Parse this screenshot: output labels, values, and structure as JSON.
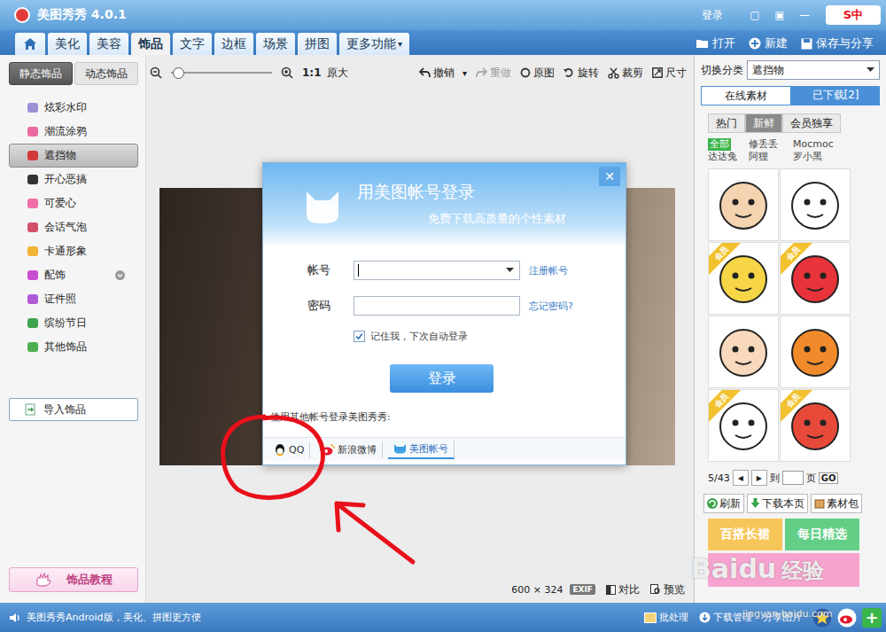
{
  "window": {
    "title": "美图秀秀 4.0.1",
    "login": "登录",
    "controls": [
      "▢",
      "▣",
      "—"
    ],
    "ime": "S中"
  },
  "tabs": [
    {
      "label": "美化",
      "selected": false
    },
    {
      "label": "美容",
      "selected": false
    },
    {
      "label": "饰品",
      "selected": true
    },
    {
      "label": "文字",
      "selected": false
    },
    {
      "label": "边框",
      "selected": false
    },
    {
      "label": "场景",
      "selected": false
    },
    {
      "label": "拼图",
      "selected": false
    }
  ],
  "more": {
    "label": "更多功能",
    "arrow": "▾"
  },
  "actions": {
    "open": "打开",
    "new": "新建",
    "save": "保存与分享"
  },
  "sidebar": {
    "tabs": [
      {
        "label": "静态饰品",
        "selected": true
      },
      {
        "label": "动态饰品",
        "selected": false
      }
    ],
    "items": [
      {
        "label": "炫彩水印",
        "selected": false,
        "expandable": false,
        "color": "#9b8fd6"
      },
      {
        "label": "潮流涂鸦",
        "selected": false,
        "expandable": false,
        "color": "#e96aa0"
      },
      {
        "label": "遮挡物",
        "selected": true,
        "expandable": false,
        "color": "#d23a3a"
      },
      {
        "label": "开心恶搞",
        "selected": false,
        "expandable": false,
        "color": "#333333"
      },
      {
        "label": "可爱心",
        "selected": false,
        "expandable": false,
        "color": "#f06fa8"
      },
      {
        "label": "会话气泡",
        "selected": false,
        "expandable": false,
        "color": "#d4506a"
      },
      {
        "label": "卡通形象",
        "selected": false,
        "expandable": false,
        "color": "#f2b233"
      },
      {
        "label": "配饰",
        "selected": false,
        "expandable": true,
        "color": "#c84fd0"
      },
      {
        "label": "证件照",
        "selected": false,
        "expandable": false,
        "color": "#b05ad8"
      },
      {
        "label": "缤纷节日",
        "selected": false,
        "expandable": false,
        "color": "#3fa34d"
      },
      {
        "label": "其他饰品",
        "selected": false,
        "expandable": false,
        "color": "#4caf50"
      }
    ],
    "import": "导入饰品",
    "tutorial": "饰品教程"
  },
  "toolbar": {
    "zoom": 0.05,
    "ratio": "1:1",
    "actual": "原大",
    "undo": "撤销",
    "undo_arrow": "▾",
    "redo": "重做",
    "redo_disabled": true,
    "original": "原图",
    "rotate": "旋转",
    "crop": "裁剪",
    "size": "尺寸"
  },
  "canvas": {
    "size": "600 × 324",
    "exif": "EXIF",
    "compare": "对比",
    "preview": "预览"
  },
  "dialog": {
    "title": "用美图帐号登录",
    "subtitle": "免费下载高质量的个性素材",
    "close": "✕",
    "account_label": "帐号",
    "account_value": "",
    "register": "注册帐号",
    "password_label": "密码",
    "forgot": "忘记密码?",
    "remember": {
      "label": "记住我，下次自动登录",
      "checked": true
    },
    "submit": "登录",
    "other_prompt": "使用其他帐号登录美图秀秀:",
    "providers": [
      {
        "label": "QQ",
        "selected": false,
        "kind": "qq"
      },
      {
        "label": "新浪微博",
        "selected": false,
        "kind": "weibo"
      },
      {
        "label": "美图帐号",
        "selected": true,
        "kind": "meitu"
      }
    ]
  },
  "right": {
    "category_label": "切换分类",
    "category": "遮挡物",
    "tabs": [
      {
        "label": "在线素材",
        "selected": true
      },
      {
        "label": "已下载[2]",
        "selected": false
      }
    ],
    "filters": [
      {
        "label": "热门",
        "selected": false
      },
      {
        "label": "新鲜",
        "selected": true
      },
      {
        "label": "会员独享",
        "selected": false
      }
    ],
    "authors": [
      {
        "label": "全部",
        "selected": true
      },
      {
        "label": "修丢丢",
        "selected": false
      },
      {
        "label": "Mocmoc",
        "selected": false
      },
      {
        "label": "达达兔",
        "selected": false
      },
      {
        "label": "阿狸",
        "selected": false
      },
      {
        "label": "罗小黑",
        "selected": false
      }
    ],
    "member_badge": "会员",
    "stickers": [
      {
        "member": false,
        "color": "#f3d3b0"
      },
      {
        "member": false,
        "color": "#ffffff"
      },
      {
        "member": true,
        "color": "#f6d646"
      },
      {
        "member": true,
        "color": "#e8333a"
      },
      {
        "member": false,
        "color": "#f9d9bd"
      },
      {
        "member": false,
        "color": "#f08a2a"
      },
      {
        "member": true,
        "color": "#ffffff"
      },
      {
        "member": true,
        "color": "#e84a3a"
      }
    ],
    "page": "5/43",
    "prev": "◀",
    "next": "▶",
    "goto": "到",
    "page_unit": "页",
    "go": "GO",
    "buttons": [
      "刷新",
      "下载本页",
      "素材包"
    ],
    "banners": [
      {
        "label": "百搭长裙",
        "color": "#f7c65a"
      },
      {
        "label": "每日精选",
        "color": "#63cf86"
      }
    ],
    "promo": {
      "color": "#f7a3cf"
    }
  },
  "status": {
    "message": "美图秀秀Android版，美化、拼图更方便",
    "batch": "批处理",
    "downloads": "下载管理",
    "share": "分享图片",
    "add": "+"
  },
  "watermark": {
    "brand": "Baidu",
    "sub": "经验",
    "url": "jingyan.baidu.com"
  }
}
